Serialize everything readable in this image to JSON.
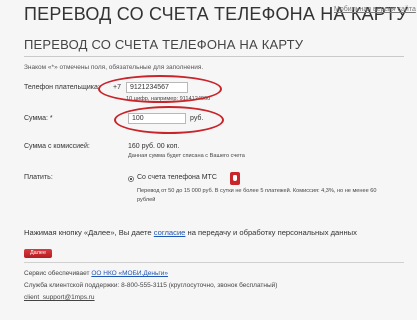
{
  "header": {
    "title": "ПЕРЕВОД СО СЧЕТА ТЕЛЕФОНА НА КАРТУ",
    "mobile_link": "Мобильная версия сайта",
    "subtitle": "ПЕРЕВОД СО СЧЕТА ТЕЛЕФОНА НА КАРТУ"
  },
  "form": {
    "required_note": "Знаком «*» отмечены поля, обязательные для заполнения.",
    "phone": {
      "label": "Телефон плательщика:",
      "prefix": "+7",
      "value": "9121234567",
      "hint": "10 цифр, например: 9114124060"
    },
    "amount": {
      "label": "Сумма: *",
      "value": "100",
      "unit": "руб."
    },
    "commission": {
      "label": "Сумма с комиссией:",
      "value": "160 руб. 00 коп.",
      "note": "Данная сумма будет списана с Вашего счета"
    },
    "pay": {
      "label": "Платить:",
      "option_label": "Со счета телефона МТС",
      "option_note_line1": "Перевод от 50 до 15 000 руб. В сутки не более 5 платежей. Комиссия: 4,3%, но не менее 60",
      "option_note_line2": "рублей",
      "selected": true
    }
  },
  "agreement": {
    "before": "Нажимая кнопку «Далее», Вы даете",
    "link": "согласие",
    "after": "на передачу и обработку персональных данных"
  },
  "buttons": {
    "next": "Далее"
  },
  "footer": {
    "service_prefix": "Сервис обеспечивает",
    "service_link": "ОО НКО «МОБИ.Деньги»",
    "support": "Служба клиентской поддержки: 8-800-555-3115 (круглосуточно, звонок бесплатный)",
    "email": "client_support@1mps.ru"
  },
  "colors": {
    "accent": "#c8242a",
    "link": "#1f56b3"
  }
}
